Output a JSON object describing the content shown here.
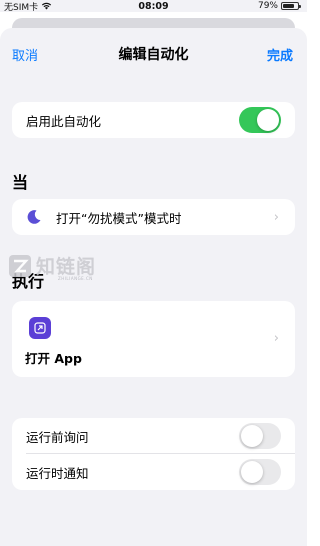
{
  "status_bar": {
    "carrier": "无SIM卡",
    "time": "08:09",
    "battery": "79%",
    "battery_level": 0.79
  },
  "nav": {
    "cancel_label": "取消",
    "title": "编辑自动化",
    "done_label": "完成"
  },
  "enable_row": {
    "label": "启用此自动化",
    "enabled": true
  },
  "when_section": {
    "header": "当",
    "trigger_label": "打开“勿扰模式”模式时"
  },
  "do_section": {
    "header": "执行",
    "action_label": "打开 App"
  },
  "options": [
    {
      "label": "运行前询问",
      "enabled": false
    },
    {
      "label": "运行时通知",
      "enabled": false
    }
  ],
  "watermark": {
    "brand": "知链阁",
    "domain": "ZHILIANGE.CN"
  },
  "colors": {
    "accent": "#0a7aff",
    "toggle_on": "#34c759",
    "moon_icon": "#5b4fd6",
    "app_icon": "#5b3fd6"
  }
}
